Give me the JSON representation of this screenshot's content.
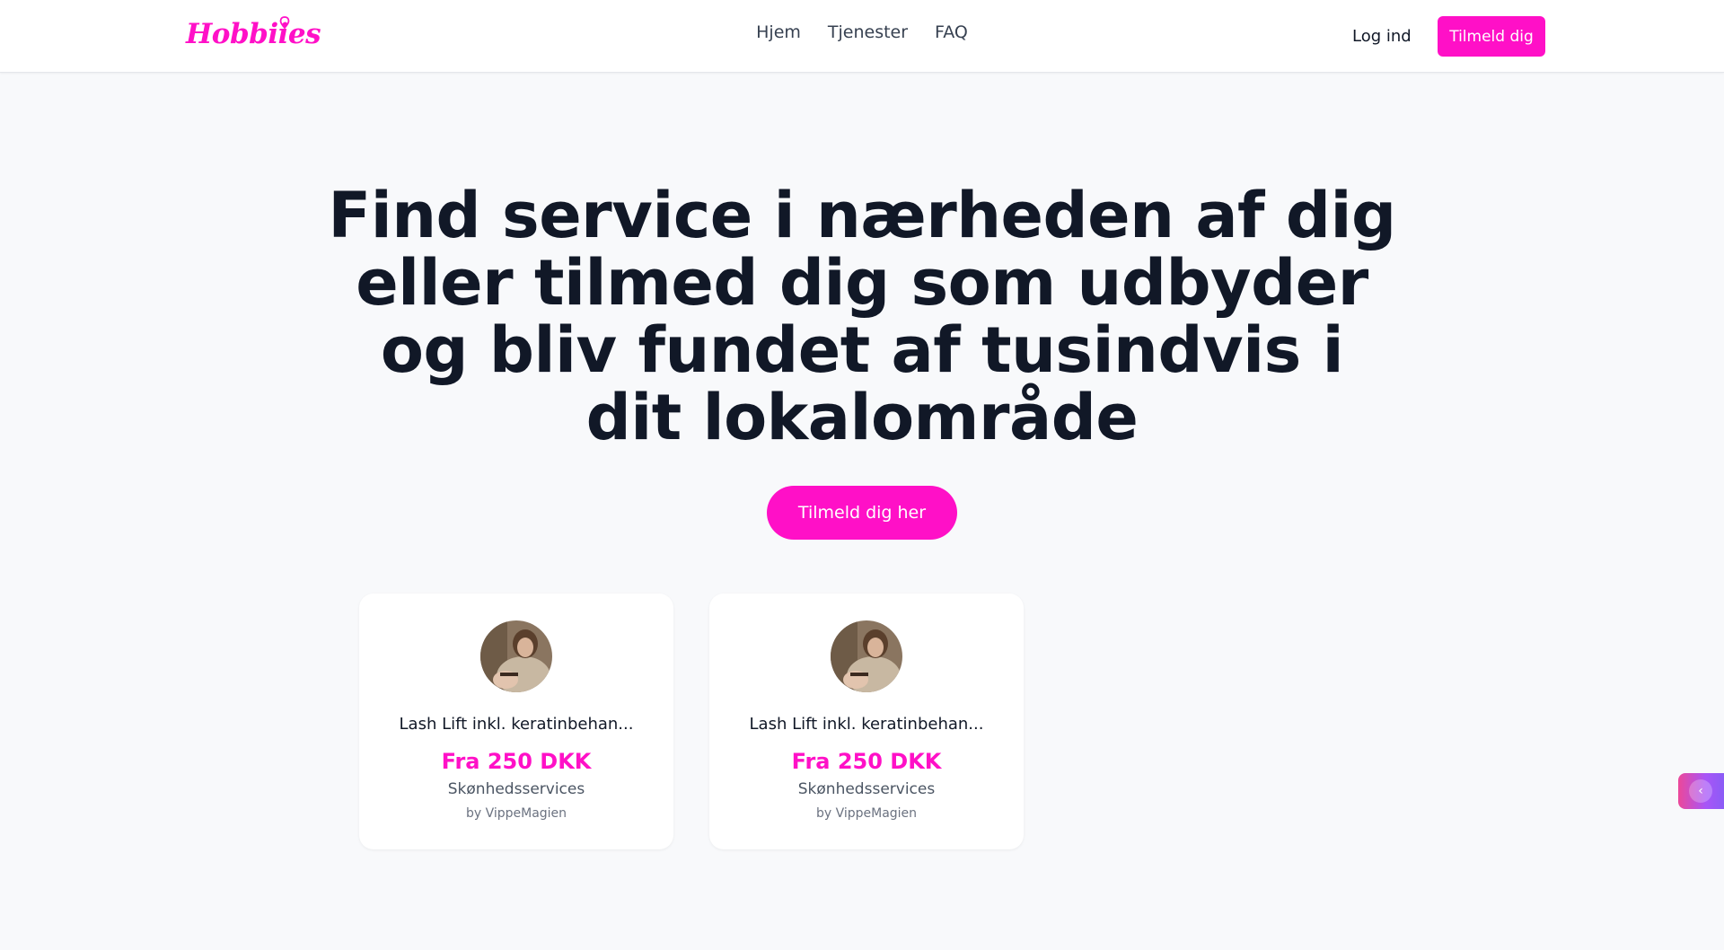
{
  "brand": {
    "logo_text": "Hobbiies",
    "accent_color": "#ff10c7"
  },
  "nav": {
    "links": [
      {
        "label": "Hjem"
      },
      {
        "label": "Tjenester"
      },
      {
        "label": "FAQ"
      }
    ],
    "login_label": "Log ind",
    "signup_label": "Tilmeld dig"
  },
  "hero": {
    "title": "Find service i nærheden af dig eller tilmed dig som udbyder og bliv fundet af tusindvis i dit lokalområde",
    "cta_label": "Tilmeld dig her"
  },
  "services": [
    {
      "title": "Lash Lift inkl. keratinbehan...",
      "price": "Fra 250 DKK",
      "category": "Skønhedsservices",
      "provider": "by VippeMagien"
    },
    {
      "title": "Lash Lift inkl. keratinbehan...",
      "price": "Fra 250 DKK",
      "category": "Skønhedsservices",
      "provider": "by VippeMagien"
    }
  ],
  "side_tab": {
    "icon": "chevron-left-icon"
  }
}
